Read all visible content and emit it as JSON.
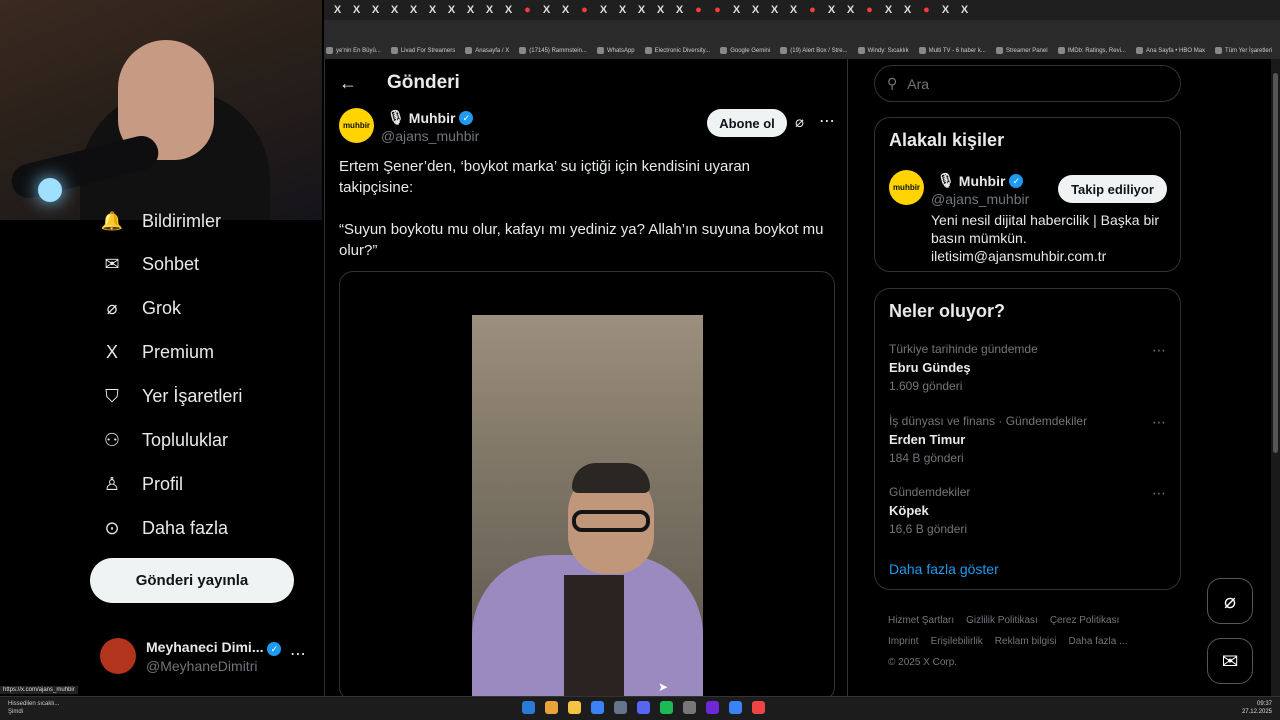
{
  "browser": {
    "tab_glyph": "X",
    "bookmarks": [
      "ye'nin En Büyü...",
      "Livad For Streamers",
      "Anasayfa / X",
      "(17145) Rammstein...",
      "WhatsApp",
      "Electronic Diversity...",
      "Google Gemini",
      "(19) Alert Box / Stre...",
      "Windy: Sıcaklık",
      "Multi TV - 6 haber k...",
      "Streamer Panel",
      "IMDb: Ratings, Revi...",
      "Ana Sayfa • HBO Max",
      "Tüm Yer İşaretleri"
    ],
    "status_url": "https://x.com/ajans_muhbir"
  },
  "nav": {
    "items": [
      {
        "label": "Bildirimler",
        "icon": "bell-icon"
      },
      {
        "label": "Sohbet",
        "icon": "mail-icon"
      },
      {
        "label": "Grok",
        "icon": "grok-icon"
      },
      {
        "label": "Premium",
        "icon": "x-logo-icon"
      },
      {
        "label": "Yer İşaretleri",
        "icon": "bookmark-icon"
      },
      {
        "label": "Topluluklar",
        "icon": "people-icon"
      },
      {
        "label": "Profil",
        "icon": "person-icon"
      },
      {
        "label": "Daha fazla",
        "icon": "more-circle-icon"
      }
    ],
    "post_button": "Gönderi yayınla",
    "account": {
      "name": "Meyhaneci Dimi...",
      "handle": "@MeyhaneDimitri"
    }
  },
  "post": {
    "page_title": "Gönderi",
    "author_name": "Muhbir",
    "author_handle": "@ajans_muhbir",
    "avatar_text": "muhbir",
    "subscribe_label": "Abone ol",
    "text_1": "Ertem Şener’den, ‘boykot marka’ su içtiği için kendisini uyaran takipçisine:",
    "text_2": "“Suyun boykotu mu olur, kafayı mı yediniz ya? Allah’ın suyuna boykot mu olur?”"
  },
  "sidebar": {
    "search_placeholder": "Ara",
    "related": {
      "title": "Alakalı kişiler",
      "name": "Muhbir",
      "handle": "@ajans_muhbir",
      "follow_label": "Takip ediliyor",
      "bio": "Yeni nesil dijital habercilik | Başka bir basın mümkün. iletisim@ajansmuhbir.com.tr"
    },
    "trends": {
      "title": "Neler oluyor?",
      "items": [
        {
          "category": "Türkiye tarihinde gündemde",
          "title": "Ebru Gündeş",
          "count": "1.609 gönderi"
        },
        {
          "category": "İş dünyası ve finans · Gündemdekiler",
          "title": "Erden Timur",
          "count": "184 B gönderi"
        },
        {
          "category": "Gündemdekiler",
          "title": "Köpek",
          "count": "16,6 B gönderi"
        }
      ],
      "show_more": "Daha fazla göster"
    },
    "footer": {
      "links": [
        "Hizmet Şartları",
        "Gizlilik Politikası",
        "Çerez Politikası",
        "Imprint",
        "Erişilebilirlik",
        "Reklam bilgisi",
        "Daha fazla ..."
      ],
      "copyright": "© 2025 X Corp."
    }
  },
  "taskbar": {
    "notification_title": "Hissedilen sıcaklı...",
    "notification_time": "Şimdi",
    "time": "09:37",
    "date": "27.12.2025"
  }
}
